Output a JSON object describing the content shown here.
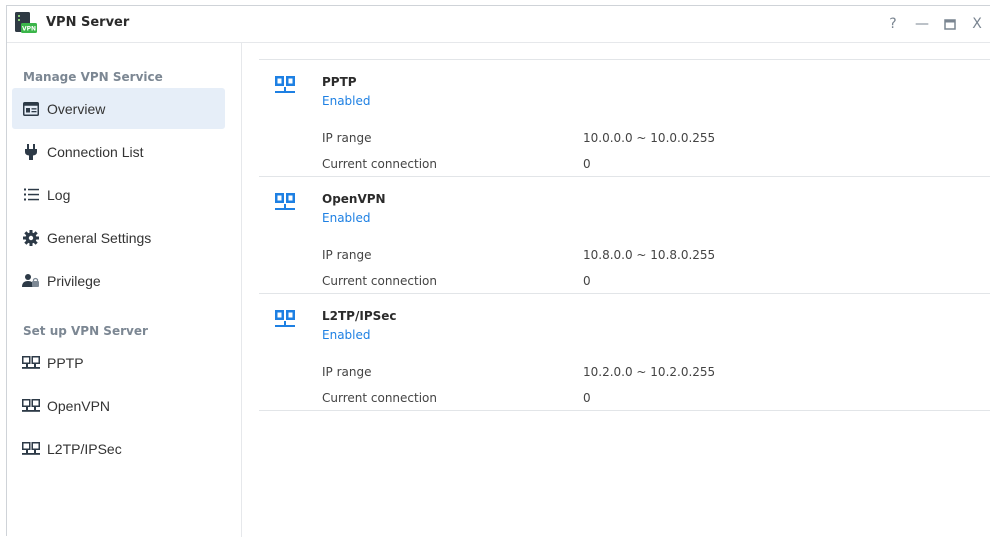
{
  "window": {
    "title": "VPN Server",
    "controls": {
      "help": "?",
      "minimize": "—",
      "maximize": "▭",
      "close": "X"
    }
  },
  "sidebar": {
    "section1": "Manage VPN Service",
    "section2": "Set up VPN Server",
    "items": [
      {
        "label": "Overview",
        "icon": "overview-icon"
      },
      {
        "label": "Connection List",
        "icon": "plug-icon"
      },
      {
        "label": "Log",
        "icon": "list-icon"
      },
      {
        "label": "General Settings",
        "icon": "gear-icon"
      },
      {
        "label": "Privilege",
        "icon": "users-icon"
      },
      {
        "label": "PPTP",
        "icon": "network-icon"
      },
      {
        "label": "OpenVPN",
        "icon": "network-icon"
      },
      {
        "label": "L2TP/IPSec",
        "icon": "network-icon"
      }
    ]
  },
  "services": [
    {
      "name": "PPTP",
      "status": "Enabled",
      "ip_label": "IP range",
      "ip_range": "10.0.0.0 ~ 10.0.0.255",
      "conn_label": "Current connection",
      "connections": "0"
    },
    {
      "name": "OpenVPN",
      "status": "Enabled",
      "ip_label": "IP range",
      "ip_range": "10.8.0.0 ~ 10.8.0.255",
      "conn_label": "Current connection",
      "connections": "0"
    },
    {
      "name": "L2TP/IPSec",
      "status": "Enabled",
      "ip_label": "IP range",
      "ip_range": "10.2.0.0 ~ 10.2.0.255",
      "conn_label": "Current connection",
      "connections": "0"
    }
  ],
  "colors": {
    "accent": "#1e80e3",
    "active_bg": "#e6eef8",
    "app_icon_green": "#3bb54a"
  }
}
